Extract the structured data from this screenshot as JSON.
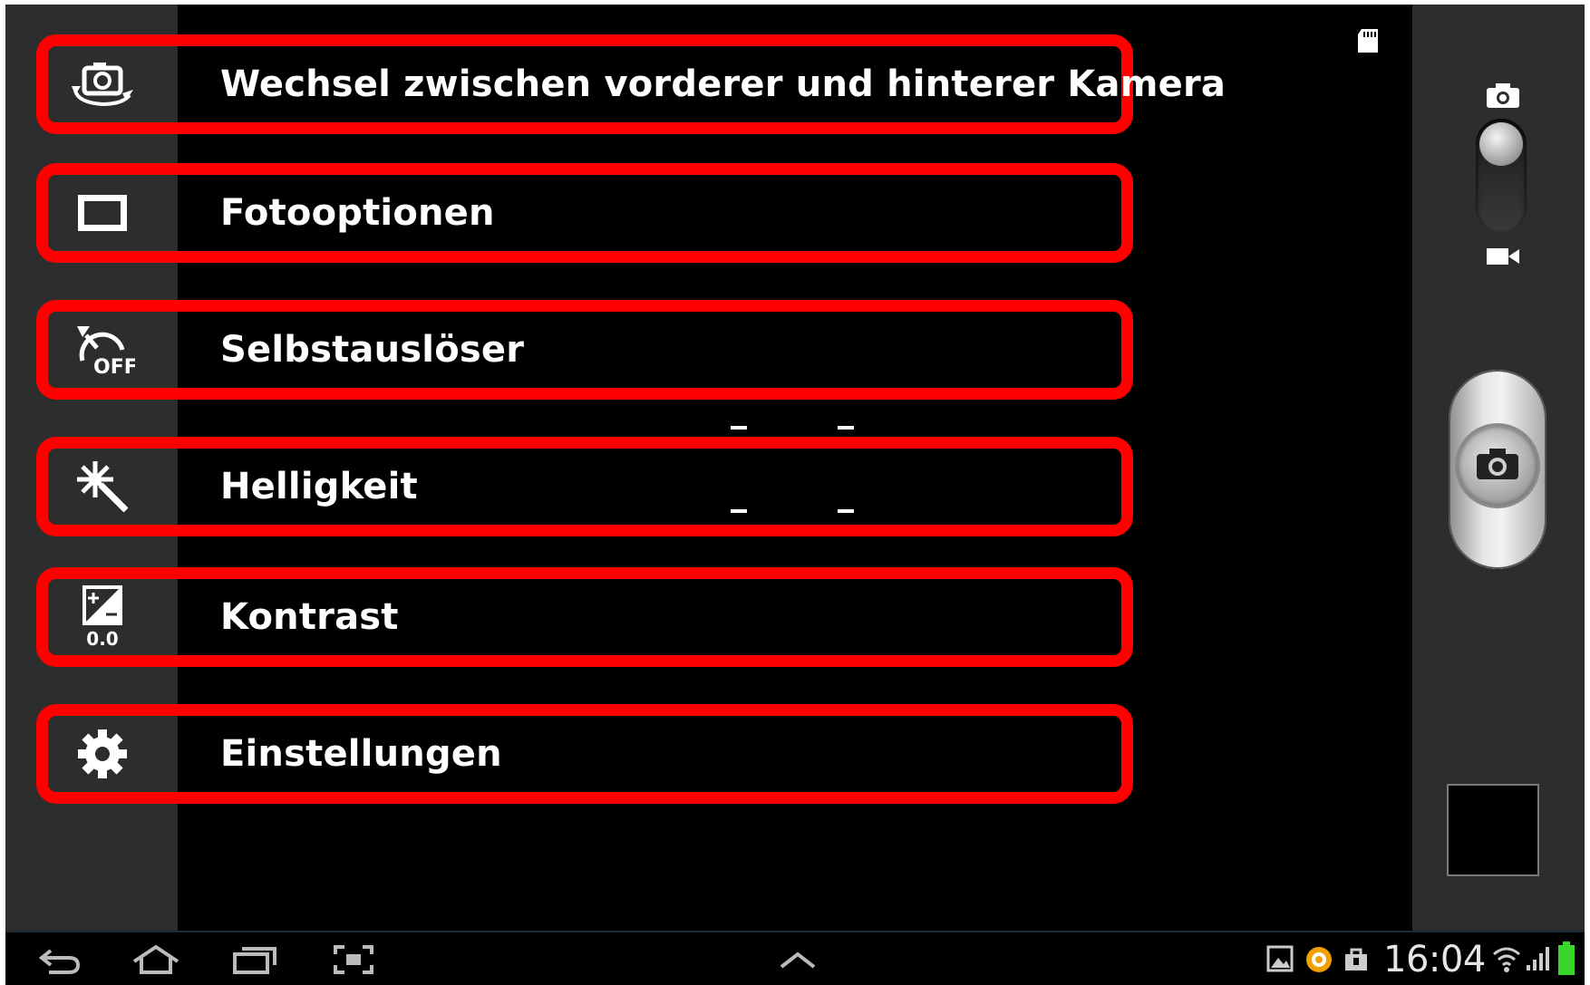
{
  "menu": {
    "items": [
      {
        "label": "Wechsel zwischen vorderer und hinterer Kamera",
        "icon": "switch-camera-icon"
      },
      {
        "label": "Fotooptionen",
        "icon": "photo-options-icon"
      },
      {
        "label": "Selbstauslöser",
        "icon": "self-timer-off-icon",
        "icon_text": "OFF"
      },
      {
        "label": "Helligkeit",
        "icon": "brightness-icon"
      },
      {
        "label": "Kontrast",
        "icon": "contrast-icon",
        "icon_text": "0.0"
      },
      {
        "label": "Einstellungen",
        "icon": "settings-gear-icon"
      }
    ],
    "highlight_color": "#ff0000"
  },
  "camera_controls": {
    "mode_switch": {
      "top_icon": "camera-icon",
      "bottom_icon": "video-camera-icon",
      "selected": "photo"
    },
    "shutter_icon": "camera-icon",
    "storage_icon": "sd-card-icon"
  },
  "nav_bar": {
    "buttons": [
      "back-icon",
      "home-icon",
      "recent-apps-icon",
      "screenshot-icon"
    ],
    "center_button": "chevron-up-icon"
  },
  "status_bar": {
    "time": "16:04",
    "icons": [
      "gallery-icon",
      "notification-circle-icon",
      "shopping-bag-icon",
      "wifi-icon",
      "signal-icon",
      "battery-icon"
    ],
    "battery_color": "#39d62b"
  }
}
